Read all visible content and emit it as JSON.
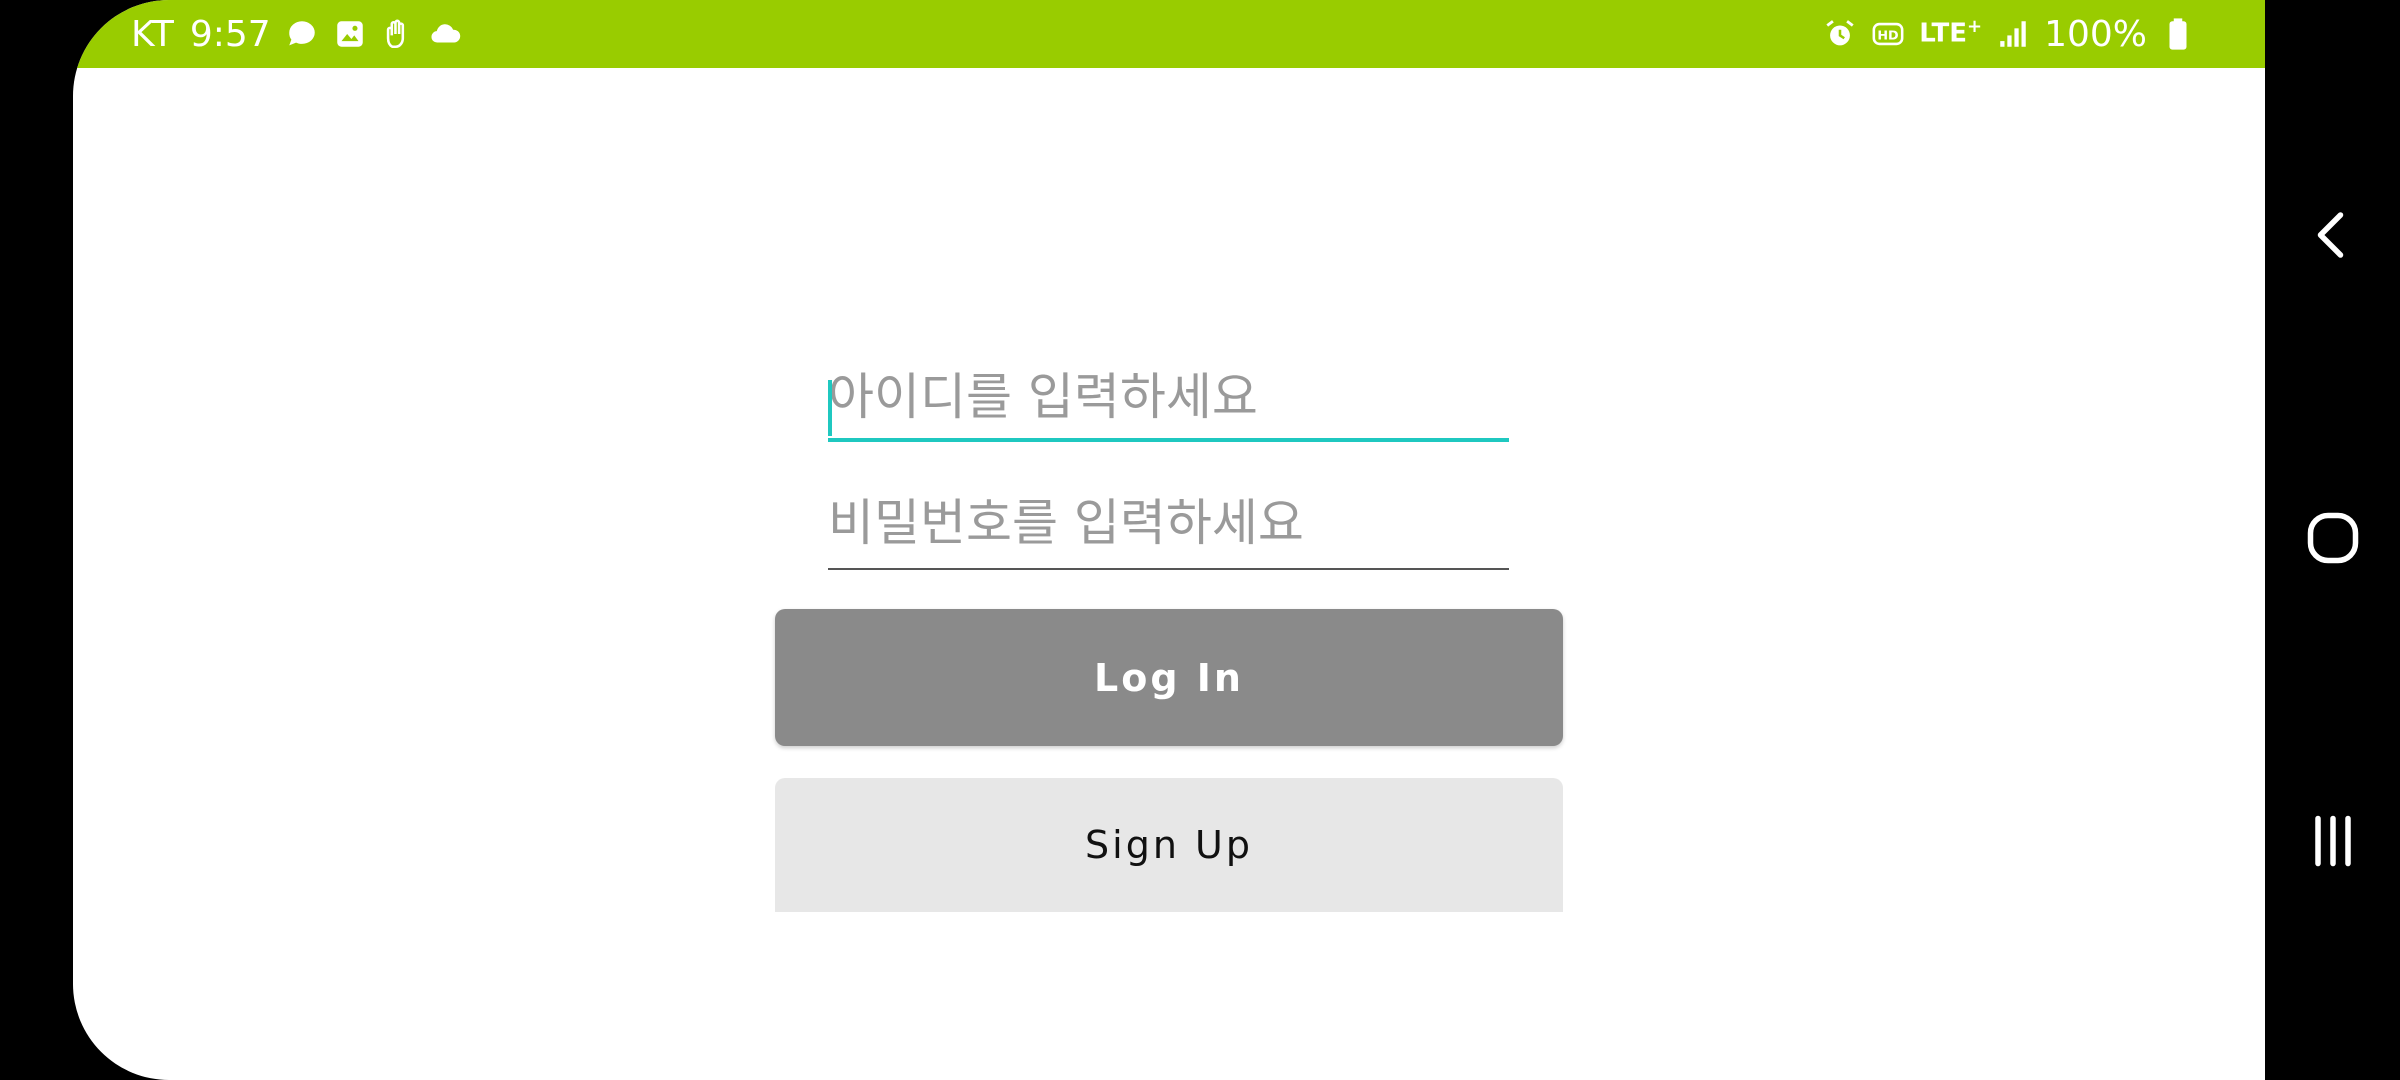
{
  "status_bar": {
    "carrier": "KT",
    "time": "9:57",
    "network": "LTE",
    "network_plus": "+",
    "battery": "100%",
    "color": "#99cc00",
    "icons_left": [
      "chat-bubble-icon",
      "gallery-icon",
      "hand-icon",
      "cloud-icon"
    ],
    "icons_right": [
      "alarm-icon",
      "hd-icon",
      "lte-icon",
      "signal-icon",
      "battery-icon"
    ]
  },
  "login_form": {
    "id_field": {
      "placeholder": "아이디를 입력하세요",
      "value": "",
      "focused": true
    },
    "password_field": {
      "placeholder": "비밀번호를 입력하세요",
      "value": ""
    },
    "login_label": "Log In",
    "signup_label": "Sign Up",
    "accent_color": "#1fc8c0"
  },
  "nav_bar": {
    "buttons": [
      "back-icon",
      "home-icon",
      "recent-apps-icon"
    ]
  }
}
